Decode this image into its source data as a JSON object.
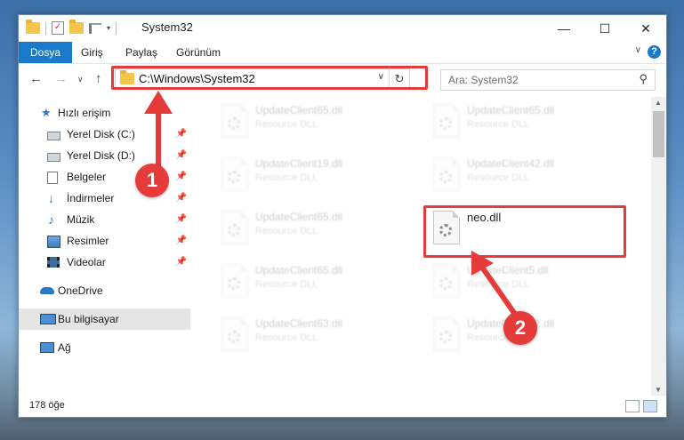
{
  "window": {
    "title": "System32",
    "controls": {
      "minimize": "—",
      "maximize": "☐",
      "close": "✕"
    }
  },
  "ribbon": {
    "tabs": [
      "Dosya",
      "Giriş",
      "Paylaş",
      "Görünüm"
    ],
    "help": "?"
  },
  "address": {
    "path": "C:\\Windows\\System32",
    "search_placeholder": "Ara: System32"
  },
  "sidebar": {
    "items": [
      {
        "label": "Hızlı erişim",
        "icon": "star-icon",
        "pinned": false
      },
      {
        "label": "Yerel Disk (C:)",
        "icon": "drive-icon",
        "pinned": true
      },
      {
        "label": "Yerel Disk (D:)",
        "icon": "drive-icon",
        "pinned": true
      },
      {
        "label": "Belgeler",
        "icon": "documents-icon",
        "pinned": true
      },
      {
        "label": "İndirmeler",
        "icon": "download-icon",
        "pinned": true
      },
      {
        "label": "Müzik",
        "icon": "music-icon",
        "pinned": true
      },
      {
        "label": "Resimler",
        "icon": "pictures-icon",
        "pinned": true
      },
      {
        "label": "Videolar",
        "icon": "videos-icon",
        "pinned": true
      },
      {
        "label": "OneDrive",
        "icon": "cloud-icon",
        "pinned": false
      },
      {
        "label": "Bu bilgisayar",
        "icon": "computer-icon",
        "pinned": false,
        "selected": true
      },
      {
        "label": "Ağ",
        "icon": "network-icon",
        "pinned": false
      }
    ]
  },
  "files": [
    {
      "name": "UpdateClient65.dll",
      "type": "Resource DLL"
    },
    {
      "name": "UpdateClient65.dll",
      "type": "Resource DLL"
    },
    {
      "name": "UpdateClient19.dll",
      "type": "Resource DLL"
    },
    {
      "name": "UpdateClient42.dll",
      "type": "Resource DLL"
    },
    {
      "name": "UpdateClient65.dll",
      "type": "Resource DLL"
    },
    {
      "name": "neo.dll",
      "type": ""
    },
    {
      "name": "UpdateClient65.dll",
      "type": "Resource DLL"
    },
    {
      "name": "UpdateClient5.dll",
      "type": "Resource DLL"
    },
    {
      "name": "UpdateClient63.dll",
      "type": "Resource DLL"
    },
    {
      "name": "UpdateClient42.dll",
      "type": "Resource DLL"
    }
  ],
  "status": {
    "count": "178 öğe"
  },
  "annotations": {
    "step1": "1",
    "step2": "2",
    "color": "#e53b3b"
  }
}
